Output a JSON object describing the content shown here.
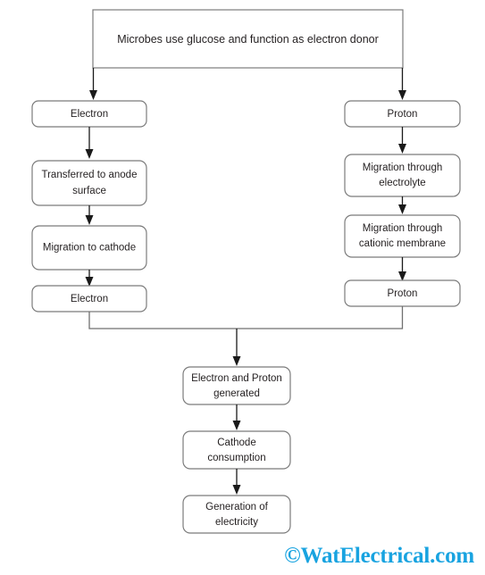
{
  "diagram": {
    "title": "Microbial fuel cell working process flowchart",
    "colors": {
      "box_border": "#7b7b7b",
      "box_fill": "#ffffff",
      "text": "#231f20",
      "connector": "#6f6f6f",
      "arrow": "#1a1a1a",
      "watermark": "#18a3e0"
    },
    "nodes": {
      "top": {
        "label": "Microbes use glucose and function as electron donor"
      },
      "left": [
        {
          "label": "Electron"
        },
        {
          "label_line1": "Transferred to anode",
          "label_line2": "surface"
        },
        {
          "label": "Migration to cathode"
        },
        {
          "label": "Electron"
        }
      ],
      "right": [
        {
          "label": "Proton"
        },
        {
          "label_line1": "Migration through",
          "label_line2": "electrolyte"
        },
        {
          "label_line1": "Migration through",
          "label_line2": "cationic membrane"
        },
        {
          "label": "Proton"
        }
      ],
      "bottom": [
        {
          "label_line1": "Electron and Proton",
          "label_line2": "generated"
        },
        {
          "label_line1": "Cathode",
          "label_line2": "consumption"
        },
        {
          "label_line1": "Generation of",
          "label_line2": "electricity"
        }
      ]
    },
    "watermark": {
      "text": "©WatElectrical.com"
    }
  }
}
